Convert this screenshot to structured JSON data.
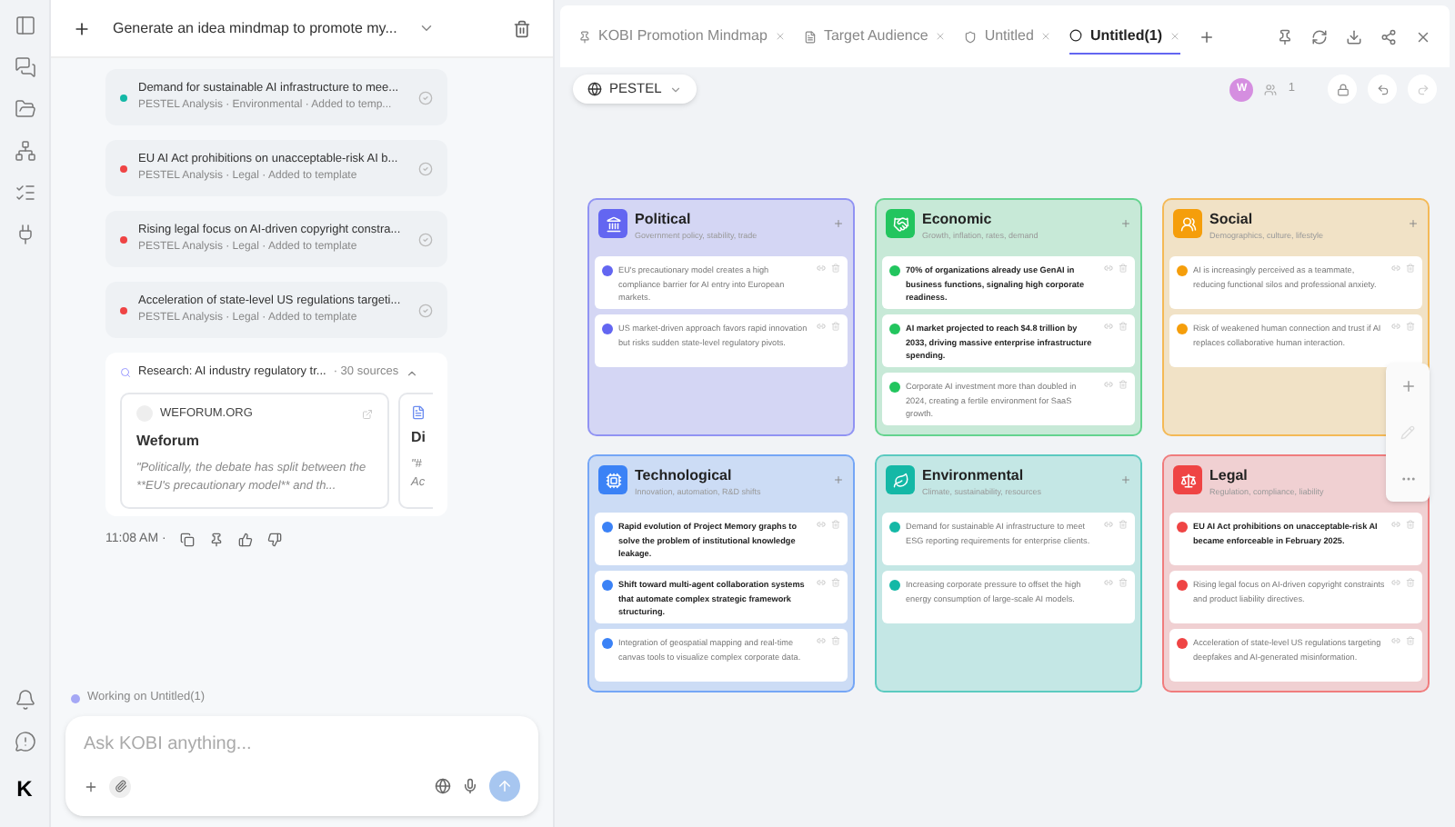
{
  "chat": {
    "title": "Generate an idea mindmap to promote my...",
    "messages": [
      {
        "text": "Demand for sustainable AI infrastructure to mee...",
        "meta": "PESTEL Analysis · Environmental · Added to temp...",
        "color": "#14b8a6"
      },
      {
        "text": "EU AI Act prohibitions on unacceptable-risk AI b...",
        "meta": "PESTEL Analysis · Legal · Added to template",
        "color": "#ef4444"
      },
      {
        "text": "Rising legal focus on AI-driven copyright constra...",
        "meta": "PESTEL Analysis · Legal · Added to template",
        "color": "#ef4444"
      },
      {
        "text": "Acceleration of state-level US regulations targeti...",
        "meta": "PESTEL Analysis · Legal · Added to template",
        "color": "#ef4444"
      }
    ],
    "research": {
      "title": "Research: AI industry regulatory tr...",
      "count": "· 30 sources"
    },
    "sources": [
      {
        "domain": "WEFORUM.ORG",
        "title": "Weforum",
        "quote": "\"Politically, the debate has split between the **EU's precautionary model** and th..."
      },
      {
        "title": "Di",
        "quote": "\"# Ac"
      }
    ],
    "time": "11:08 AM ·",
    "working": "Working on Untitled(1)",
    "input": {
      "placeholder": "Ask KOBI anything..."
    },
    "logo": "K"
  },
  "tabs": [
    {
      "label": "KOBI Promotion Mindmap",
      "selected": false
    },
    {
      "label": "Target Audience",
      "selected": false
    },
    {
      "label": "Untitled",
      "selected": false
    },
    {
      "label": "Untitled(1)",
      "selected": true
    }
  ],
  "toolbar": {
    "framework": "PESTEL",
    "avatar": "W",
    "users": "1"
  },
  "cards": [
    {
      "title": "Political",
      "subtitle": "Government policy, stability, trade",
      "color": "#6366f1",
      "items": [
        {
          "text": "EU's precautionary model creates a high compliance barrier for AI entry into European markets.",
          "bold": false
        },
        {
          "text": "US market-driven approach favors rapid innovation but risks sudden state-level regulatory pivots.",
          "bold": false
        }
      ]
    },
    {
      "title": "Economic",
      "subtitle": "Growth, inflation, rates, demand",
      "color": "#22c55e",
      "items": [
        {
          "text": "70% of organizations already use GenAI in business functions, signaling high corporate readiness.",
          "bold": true
        },
        {
          "text": "AI market projected to reach $4.8 trillion by 2033, driving massive enterprise infrastructure spending.",
          "bold": true
        },
        {
          "text": "Corporate AI investment more than doubled in 2024, creating a fertile environment for SaaS growth.",
          "bold": false
        }
      ]
    },
    {
      "title": "Social",
      "subtitle": "Demographics, culture, lifestyle",
      "color": "#f59e0b",
      "items": [
        {
          "text": "AI is increasingly perceived as a teammate, reducing functional silos and professional anxiety.",
          "bold": false
        },
        {
          "text": "Risk of weakened human connection and trust if AI replaces collaborative human interaction.",
          "bold": false
        }
      ]
    },
    {
      "title": "Technological",
      "subtitle": "Innovation, automation, R&D shifts",
      "color": "#3b82f6",
      "items": [
        {
          "text": "Rapid evolution of Project Memory graphs to solve the problem of institutional knowledge leakage.",
          "bold": true
        },
        {
          "text": "Shift toward multi-agent collaboration systems that automate complex strategic framework structuring.",
          "bold": true
        },
        {
          "text": "Integration of geospatial mapping and real-time canvas tools to visualize complex corporate data.",
          "bold": false
        }
      ]
    },
    {
      "title": "Environmental",
      "subtitle": "Climate, sustainability, resources",
      "color": "#14b8a6",
      "items": [
        {
          "text": "Demand for sustainable AI infrastructure to meet ESG reporting requirements for enterprise clients.",
          "bold": false
        },
        {
          "text": "Increasing corporate pressure to offset the high energy consumption of large-scale AI models.",
          "bold": false
        }
      ]
    },
    {
      "title": "Legal",
      "subtitle": "Regulation, compliance, liability",
      "color": "#ef4444",
      "items": [
        {
          "text": "EU AI Act prohibitions on unacceptable-risk AI became enforceable in February 2025.",
          "bold": true
        },
        {
          "text": "Rising legal focus on AI-driven copyright constraints and product liability directives.",
          "bold": false
        },
        {
          "text": "Acceleration of state-level US regulations targeting deepfakes and AI-generated misinformation.",
          "bold": false
        }
      ]
    }
  ]
}
